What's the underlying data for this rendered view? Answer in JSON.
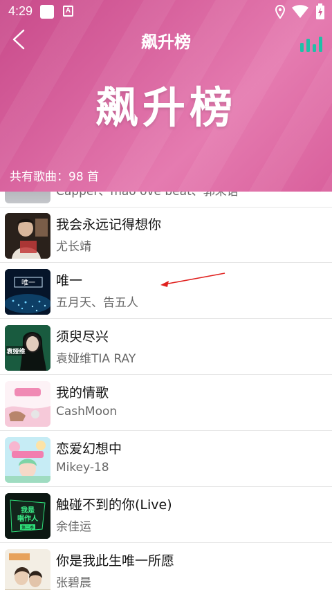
{
  "status_bar": {
    "time": "4:29",
    "notification_a": "A",
    "icons": [
      "location-icon",
      "wifi-icon",
      "battery-charging-icon"
    ]
  },
  "header": {
    "nav_title": "飙升榜",
    "big_title": "飙升榜",
    "song_count": "共有歌曲：98 首",
    "colors": {
      "gradient_start": "#c84a8a",
      "gradient_end": "#e57bb0",
      "eq_icon": "#1fc0a7"
    }
  },
  "songs": [
    {
      "title": "",
      "artist": "Capper、mao ove beat、郭来语"
    },
    {
      "title": "我会永远记得想你",
      "artist": "尤长靖"
    },
    {
      "title": "唯一",
      "artist": "五月天、告五人"
    },
    {
      "title": "须臾尽兴",
      "artist": "袁娅维TIA RAY"
    },
    {
      "title": "我的情歌",
      "artist": "CashMoon"
    },
    {
      "title": "恋爱幻想中",
      "artist": "Mikey-18"
    },
    {
      "title": "触碰不到的你(Live)",
      "artist": "余佳运"
    },
    {
      "title": "你是我此生唯一所愿",
      "artist": "张碧晨"
    }
  ],
  "cover_texts": {
    "song2": "唯一",
    "song3": "袁娅维",
    "song6_a": "我是",
    "song6_b": "唱作人",
    "song6_c": "第二季"
  }
}
